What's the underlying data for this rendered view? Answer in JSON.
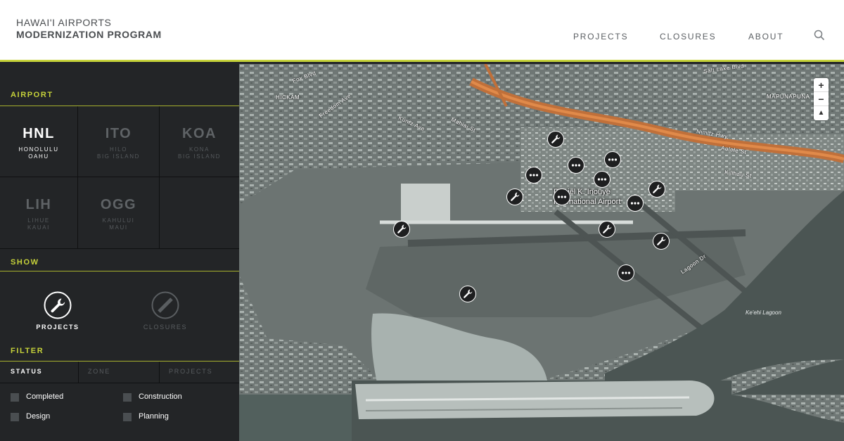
{
  "header": {
    "logo_line1": "HAWAI'I AIRPORTS",
    "logo_line2": "MODERNIZATION PROGRAM",
    "nav": {
      "projects": "PROJECTS",
      "closures": "CLOSURES",
      "about": "ABOUT"
    }
  },
  "sidebar": {
    "airport_label": "AIRPORT",
    "airports": [
      {
        "code": "HNL",
        "sub": "HONOLULU\nOAHU",
        "active": true
      },
      {
        "code": "ITO",
        "sub": "HILO\nBIG ISLAND",
        "active": false
      },
      {
        "code": "KOA",
        "sub": "KONA\nBIG ISLAND",
        "active": false
      },
      {
        "code": "LIH",
        "sub": "LIHUE\nKAUAI",
        "active": false
      },
      {
        "code": "OGG",
        "sub": "KAHULUI\nMAUI",
        "active": false
      }
    ],
    "show_label": "SHOW",
    "show": {
      "projects": "PROJECTS",
      "closures": "CLOSURES"
    },
    "filter_label": "FILTER",
    "filter_tabs": {
      "status": "STATUS",
      "zone": "ZONE",
      "projects": "PROJECTS"
    },
    "statuses": {
      "completed": "Completed",
      "construction": "Construction",
      "design": "Design",
      "planning": "Planning"
    }
  },
  "map": {
    "airport_name_line1": "Daniel K. Inouye",
    "airport_name_line2": "International Airport",
    "labels": {
      "hickam": "HICKAM",
      "mapunapuna": "MAPUNAPUNA",
      "salt_lake": "Salt Lake Blvd",
      "fox": "Fox Blvd",
      "kuntz": "Kuntz Ave",
      "nimitz": "Nimitz Hwy",
      "lagoon_dr": "Lagoon Dr",
      "freedom": "Freedom Ave",
      "aolele": "Aolele St",
      "kilihau": "Kilihau St",
      "mahiai": "Mahiai St"
    },
    "lagoon": "Ke'ehi Lagoon",
    "zoom": {
      "in": "+",
      "out": "−",
      "compass": "▲"
    }
  },
  "colors": {
    "accent": "#c6d23a",
    "sidebar_bg": "#232527",
    "marker": "#1e1f20"
  },
  "icons": {
    "search": "search-icon",
    "wrench": "wrench-icon",
    "dots": "dots-icon",
    "closure": "closure-icon"
  }
}
